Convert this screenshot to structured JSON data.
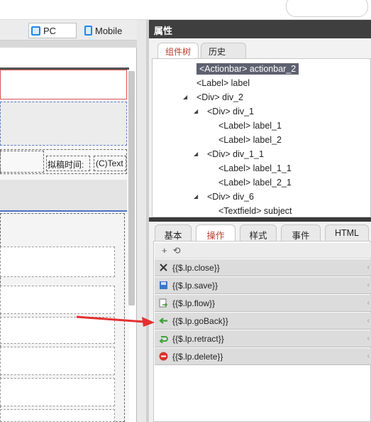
{
  "view_switch": {
    "pc": "PC",
    "mobile": "Mobile"
  },
  "canvas": {
    "draft_time_label": "拟稿时间:",
    "text_field": "(C)Text"
  },
  "properties": {
    "title": "属性",
    "tabs": [
      "组件树",
      "历史"
    ],
    "tree": [
      {
        "label": "<Actionbar> actionbar_2",
        "depth": 1,
        "selected": true,
        "expanded": null
      },
      {
        "label": "<Label> label",
        "depth": 1,
        "selected": false,
        "expanded": null
      },
      {
        "label": "<Div> div_2",
        "depth": 1,
        "selected": false,
        "expanded": true
      },
      {
        "label": "<Div> div_1",
        "depth": 2,
        "selected": false,
        "expanded": true
      },
      {
        "label": "<Label> label_1",
        "depth": 3,
        "selected": false,
        "expanded": null
      },
      {
        "label": "<Label> label_2",
        "depth": 3,
        "selected": false,
        "expanded": null
      },
      {
        "label": "<Div> div_1_1",
        "depth": 2,
        "selected": false,
        "expanded": true
      },
      {
        "label": "<Label> label_1_1",
        "depth": 3,
        "selected": false,
        "expanded": null
      },
      {
        "label": "<Label> label_2_1",
        "depth": 3,
        "selected": false,
        "expanded": null
      },
      {
        "label": "<Div> div_6",
        "depth": 2,
        "selected": false,
        "expanded": true
      },
      {
        "label": "<Textfield> subject",
        "depth": 3,
        "selected": false,
        "expanded": null
      }
    ]
  },
  "panel2": {
    "tabs": [
      "基本",
      "操作",
      "样式",
      "事件",
      "HTML"
    ],
    "active_tab": 1,
    "toolbar": {
      "add": "+",
      "refresh": "⟲"
    },
    "actions": [
      {
        "label": "{{$.lp.close}}",
        "icon": "close-icon",
        "color": "#333333"
      },
      {
        "label": "{{$.lp.save}}",
        "icon": "save-icon",
        "color": "#3b78c3"
      },
      {
        "label": "{{$.lp.flow}}",
        "icon": "flow-icon",
        "color": "#4a9a3c"
      },
      {
        "label": "{{$.lp.goBack}}",
        "icon": "back-arrow-icon",
        "color": "#3ea23a"
      },
      {
        "label": "{{$.lp.retract}}",
        "icon": "retract-icon",
        "color": "#3ea23a"
      },
      {
        "label": "{{$.lp.delete}}",
        "icon": "delete-icon",
        "color": "#d9342b"
      }
    ],
    "chevron": "‹"
  },
  "annotation": {
    "color": "#e53030"
  }
}
